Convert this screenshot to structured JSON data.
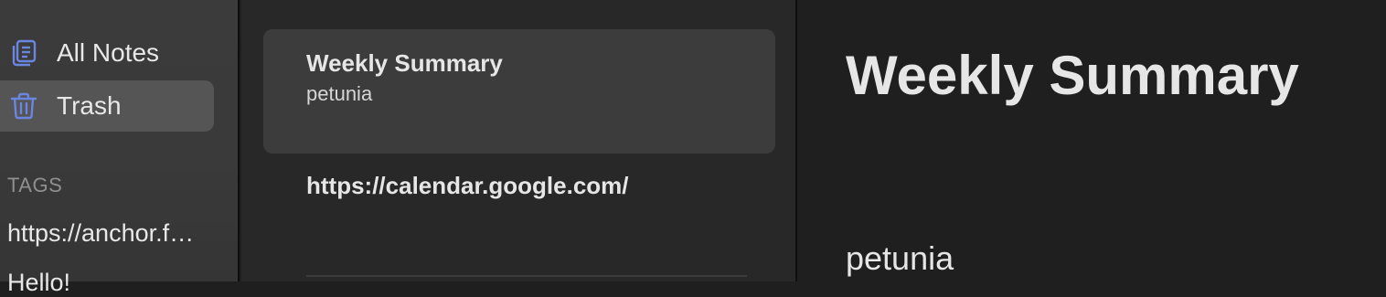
{
  "sidebar": {
    "items": [
      {
        "label": "All Notes",
        "icon": "notes-stack-icon"
      },
      {
        "label": "Trash",
        "icon": "trash-icon"
      }
    ],
    "tags_header": "TAGS",
    "tags": [
      "https://anchor.f…",
      "Hello!"
    ]
  },
  "note_list": {
    "notes": [
      {
        "title": "Weekly Summary",
        "snippet": "petunia"
      },
      {
        "title": "https://calendar.google.com/"
      }
    ]
  },
  "editor": {
    "title": "Weekly Summary",
    "body": "petunia"
  },
  "colors": {
    "icon_accent": "#6b86e0",
    "active_item_bg": "#555555",
    "selected_card_bg": "#3c3c3c"
  }
}
